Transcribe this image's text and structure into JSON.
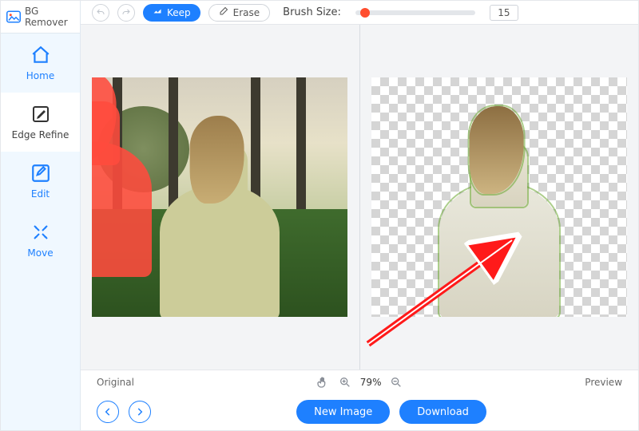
{
  "app_title": "BG Remover",
  "sidebar": {
    "items": [
      {
        "label": "Home",
        "icon": "home-icon"
      },
      {
        "label": "Edge Refine",
        "icon": "edge-refine-icon"
      },
      {
        "label": "Edit",
        "icon": "edit-icon"
      },
      {
        "label": "Move",
        "icon": "move-icon"
      }
    ],
    "active_index": 1
  },
  "toolbar": {
    "undo_icon": "undo-icon",
    "redo_icon": "redo-icon",
    "keep_label": "Keep",
    "erase_label": "Erase",
    "brush_label": "Brush Size:",
    "brush_value": "15",
    "accent": "#1e80ff",
    "slider_thumb_color": "#ff4d2e"
  },
  "workspace": {
    "left_label": "Original",
    "right_label": "Preview",
    "zoom_percent": "79%"
  },
  "footer": {
    "new_image_label": "New Image",
    "download_label": "Download"
  }
}
